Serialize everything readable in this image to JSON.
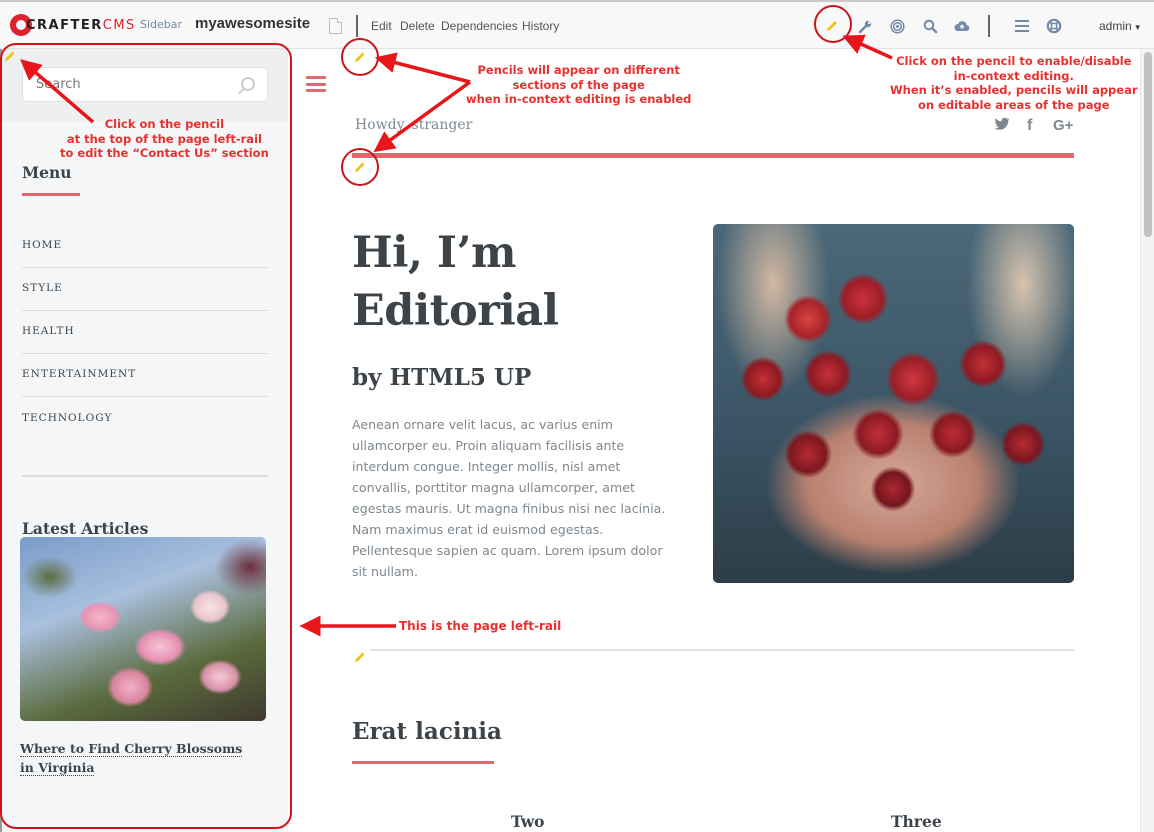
{
  "toolbar": {
    "logo_crafter": "CRAFTER",
    "logo_cms": "CMS",
    "sidebar_label": "Sidebar",
    "site_name": "myawesomesite",
    "actions": [
      "Edit",
      "Delete",
      "Dependencies",
      "History"
    ],
    "icons": [
      "pencil-icon",
      "wrench-icon",
      "target-icon",
      "search-icon",
      "cloud-upload-icon",
      "menu-icon",
      "lifebuoy-icon"
    ],
    "user": "admin",
    "pencil_color": "#f0c419"
  },
  "left_rail": {
    "search_placeholder": "Search",
    "menu_heading": "Menu",
    "menu_items": [
      "HOME",
      "STYLE",
      "HEALTH",
      "ENTERTAINMENT",
      "TECHNOLOGY"
    ],
    "latest_heading": "Latest Articles",
    "article_title": "Where to Find Cherry Blossoms in Virginia"
  },
  "main": {
    "greeting": "Howdy, stranger",
    "social": [
      "twitter-icon",
      "facebook-icon",
      "google-plus-icon"
    ],
    "social_glyphs": [
      "🐦",
      "f",
      "G+"
    ],
    "hero_title_line1": "Hi, I’m",
    "hero_title_line2": "Editorial",
    "hero_subtitle": "by HTML5 UP",
    "hero_paragraph": "Aenean ornare velit lacus, ac varius enim ullamcorper eu. Proin aliquam facilisis ante interdum congue. Integer mollis, nisl amet convallis, porttitor magna ullamcorper, amet egestas mauris. Ut magna finibus nisi nec lacinia. Nam maximus erat id euismod egestas. Pellentesque sapien ac quam. Lorem ipsum dolor sit nullam.",
    "section_title": "Erat lacinia",
    "columns": [
      "Two",
      "Three"
    ],
    "accent_color": "#e06870"
  },
  "annotations": {
    "toolbar_pencil": [
      "Click on the pencil to enable/disable",
      "in-context editing.",
      "When it’s enabled, pencils will appear",
      "on editable areas of the page"
    ],
    "section_pencils": [
      "Pencils will appear on different",
      "sections of the page",
      "when in-context editing is enabled"
    ],
    "rail_pencil": [
      "Click on the pencil",
      "at the top of the page left-rail",
      "to edit the “Contact Us” section"
    ],
    "left_rail": "This is the page left-rail",
    "color": "#e8312f"
  }
}
